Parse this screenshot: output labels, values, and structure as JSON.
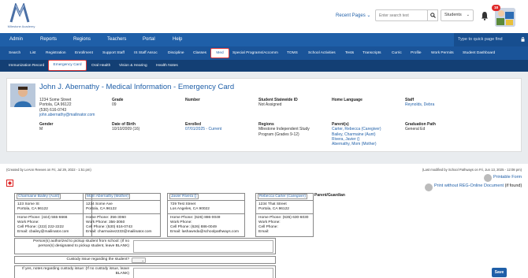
{
  "app": {
    "logo_text": "Milestone Academy"
  },
  "header": {
    "recent_pages": "Recent Pages",
    "search_placeholder": "Enter search text",
    "scope": "Students",
    "notification_count": "18"
  },
  "mainnav": {
    "items": [
      "Admin",
      "Reports",
      "Regions",
      "Teachers",
      "Portal",
      "Help"
    ],
    "quick_find_placeholder": "Type to quick page find"
  },
  "subnav": {
    "items": [
      "Search",
      "List",
      "Registration",
      "Enrollment",
      "Support Staff",
      "IS Staff Assoc",
      "Discipline",
      "Classes",
      "Med",
      "Special Programs/Accomm",
      "TOMS",
      "School Activities",
      "Tests",
      "Transcripts",
      "Curric",
      "Profile",
      "Work Permits",
      "Student Dashboard"
    ],
    "active": "Med"
  },
  "tabs": {
    "items": [
      "Immunization Record",
      "Emergency Card",
      "Oral Health",
      "Vision & Hearing",
      "Health Notes"
    ],
    "active": "Emergency Card"
  },
  "student": {
    "title": "John J. Abernathy - Medical Information - Emergency Card",
    "address1": "1234 Some Street",
    "address2": "Portola, CA 96122",
    "phone": "(530) 616-0743",
    "email": "john.abernathy@mailinator.com",
    "grade_label": "Grade",
    "grade": "09",
    "number_label": "Number",
    "number": "",
    "ssid_label": "Student Statewide ID",
    "ssid": "Not Assigned",
    "home_language_label": "Home Language",
    "home_language": "",
    "staff_label": "Staff",
    "staff": "Reynolds, Debra",
    "gender_label": "Gender",
    "gender": "M",
    "dob_label": "Date of Birth",
    "dob": "10/10/2009 (16)",
    "enrolled_label": "Enrolled",
    "enrolled": "07/01/2025 - Current",
    "regions_label": "Regions",
    "regions1": "Milestone Independent Study",
    "regions2": "Program (Grades 9-12)",
    "parents_label": "Parent(s)",
    "parents": [
      "Carter, Rebecca (Caregiver)",
      "Bailey, Charmaine (Aunt)",
      "Rivera, Javier ()",
      "Abernathy, Mom (Mother)"
    ],
    "graduation_label": "Graduation Path",
    "graduation": "General Ed"
  },
  "meta": {
    "created": "(Created by LeAnn Reeves on Fri, Jul 29, 2022 - 1:51 pm)",
    "modified": "(Last modified by School Pathways on Fri, Jun 13, 2025 - 12:08 pm)",
    "printable_form": "Printable Form",
    "print_without": "Print without REG-Online Document",
    "if_found": " (if found)"
  },
  "parent_guardian_label": "Parent/Guardian",
  "parent_cards": [
    {
      "name": "Charmaine Bailey (Aunt)",
      "addr1": "123 Some St",
      "addr2": "Portola, CA 96122",
      "home": "Home Phone: (444) 555-6666",
      "work": "Work Phone:",
      "cell": "Cell Phone: (222) 222-2222",
      "email": "Email: cbailey@mailinator.com"
    },
    {
      "name": "Mom Abernathy (Mother)",
      "addr1": "1234 Some Ave",
      "addr2": "Portola, CA 96122",
      "home": "Home Phone: 356-3060",
      "work": "Work Phone: 356-3060",
      "cell": "Cell Phone: (530) 616-0743",
      "email": "Email: charmaine2233@mailinator.com"
    },
    {
      "name": "Javier Rivera ()",
      "addr1": "729 Test Street",
      "addr2": "Los Angeles, CA 90022",
      "home": "Home Phone: (626) 886-0049",
      "work": "Work Phone:",
      "cell": "Cell Phone: (626) 886-0049",
      "email": "Email: lashawnda@schoolpathways.com"
    },
    {
      "name": "Rebecca Carter (Caregiver)",
      "addr1": "1234 That Street",
      "addr2": "Portola, CA 96122",
      "home": "Home Phone: (635) 630-6030",
      "work": "Work Phone:",
      "cell": "Cell Phone:",
      "email": "Email:"
    }
  ],
  "form": {
    "pickup_label": "Person(s) authorized to pickup student from school: (If no person(s) designated to pickup student, leave BLANK)",
    "custody_label": "Custody issue regarding the student?",
    "custody_notes_label": "If yes, notes regarding custody issue: (If no custody issue, leave BLANK)",
    "save": "Save"
  },
  "colors": {
    "brand": "#1f5fa8",
    "active_outline": "#e23c3c",
    "badge": "#e02b2b"
  }
}
